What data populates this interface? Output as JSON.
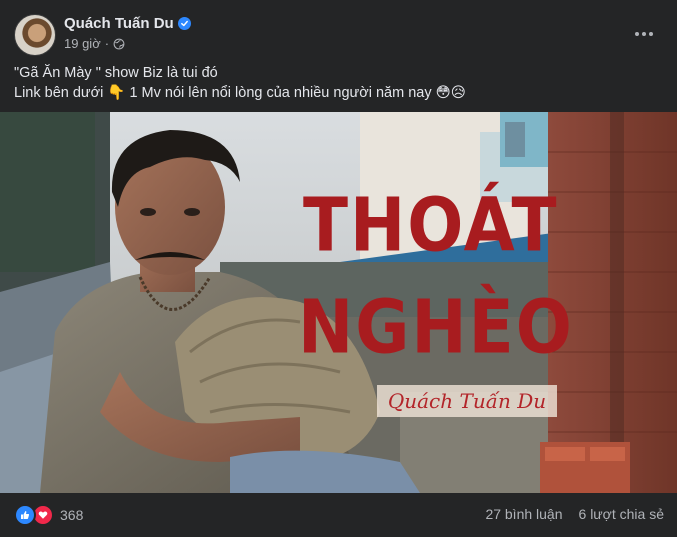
{
  "post": {
    "author": "Quách Tuấn Du",
    "time": "19 giờ",
    "caption_line1": "\"Gã Ăn Mày \" show Biz là tui đó",
    "caption_line2": "Link bên dưới 👇 1 Mv nói lên nổi lòng của nhiều người năm nay 😳😥"
  },
  "media": {
    "title_line1": "THOÁT",
    "title_line2": "NGHÈO",
    "subtitle": "Quách Tuấn Du"
  },
  "footer": {
    "reaction_count": "368",
    "comments": "27 bình luận",
    "shares": "6 lượt chia sẻ"
  },
  "colors": {
    "background": "#242526",
    "title_red": "#a81c1f",
    "like_blue": "#2d88ff",
    "love_red": "#f0284a"
  },
  "icons": [
    "verified-badge-icon",
    "globe-icon",
    "more-options-icon",
    "like-reaction-icon",
    "love-reaction-icon"
  ]
}
